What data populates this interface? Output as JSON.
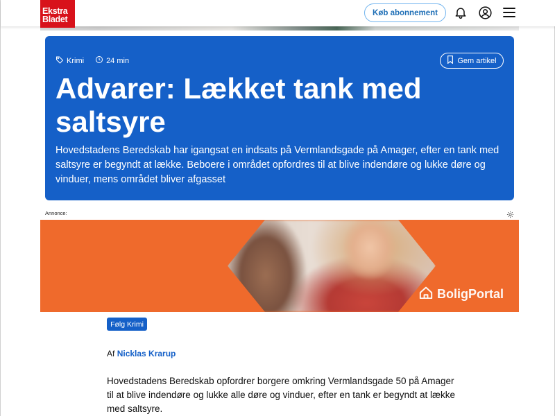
{
  "header": {
    "logo_line1": "Ekstra",
    "logo_line2": "Bladet",
    "subscribe_label": "Køb abonnement",
    "brand_color": "#d8121b"
  },
  "article": {
    "tag": "Krimi",
    "read_time": "24 min",
    "save_label": "Gem artikel",
    "headline": "Advarer: Lækket tank med saltsyre",
    "summary": "Hovedstadens Beredskab har igangsat en indsats på  Vermlandsgade på Amager, efter en tank med saltsyre er begyndt at lække. Beboere i området opfordres til at blive indendøre og lukke døre og vinduer, mens området bliver afgasset",
    "accent_color": "#1560c8",
    "follow_label": "Følg Krimi",
    "byline_prefix": "Af",
    "author": "Nicklas Krarup",
    "body": "Hovedstadens Beredskab opfordrer borgere omkring Vermlandsgade 50 på Amager til at blive indendøre og lukke alle døre og vinduer, efter en tank er begyndt at lække med saltsyre."
  },
  "ad": {
    "label": "Annonce:",
    "brand": "BoligPortal",
    "background_color": "#ef6a2c"
  },
  "icons": {
    "tag": "tag-icon",
    "clock": "clock-icon",
    "bookmark": "bookmark-icon",
    "bell": "bell-icon",
    "user": "user-icon",
    "menu": "hamburger-menu-icon",
    "ad_settings": "gear-icon",
    "ad_brand": "house-icon"
  }
}
